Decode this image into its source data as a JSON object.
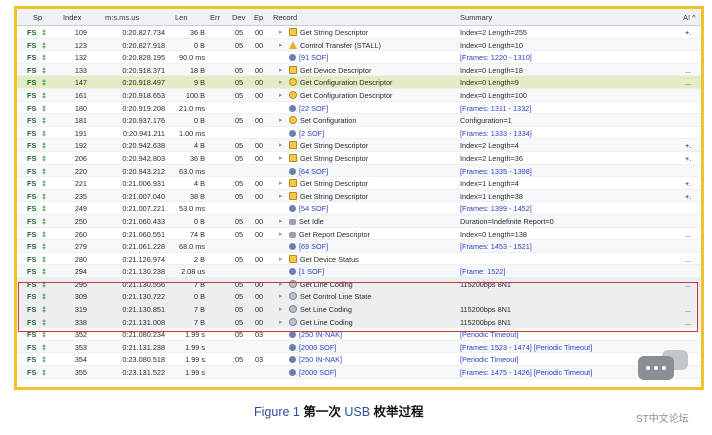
{
  "table": {
    "headers": {
      "sp": "Sp",
      "index": "Index",
      "time": "m:s.ms.us",
      "len": "Len",
      "err": "Err",
      "dev": "Dev",
      "ep": "Ep",
      "record": "Record",
      "summary": "Summary",
      "extra": "A! ^"
    },
    "rows": [
      {
        "sp": "FS",
        "index": "109",
        "time": "0:20.827.734",
        "len": "36 B",
        "dev": "05",
        "ep": "00",
        "icon": "descriptor-icon",
        "record": "Get String Descriptor",
        "summary": "Index=2 Length=255",
        "extra": "+."
      },
      {
        "sp": "FS",
        "index": "123",
        "time": "0:20.827.918",
        "len": "0 B",
        "dev": "05",
        "ep": "00",
        "icon": "warning-icon",
        "record": "Control Transfer (STALL)",
        "summary": "Index=0 Length=10",
        "extra": ""
      },
      {
        "sp": "FS",
        "index": "132",
        "time": "0:20.828.195",
        "len": "90.0 ms",
        "dev": "",
        "ep": "",
        "icon": "sof-icon",
        "record": "[91 SOF]",
        "summary": "[Frames: 1220 - 1310]",
        "extra": ""
      },
      {
        "sp": "FS",
        "index": "133",
        "time": "0:20.918.371",
        "len": "18 B",
        "dev": "05",
        "ep": "00",
        "icon": "descriptor-icon",
        "record": "Get Device Descriptor",
        "summary": "Index=0 Length=18",
        "extra": "..."
      },
      {
        "sp": "FS",
        "index": "147",
        "time": "0:20.918.497",
        "len": "9 B",
        "dev": "05",
        "ep": "00",
        "icon": "config-icon",
        "record": "Get Configuration Descriptor",
        "summary": "Index=0 Length=9",
        "extra": "..."
      },
      {
        "sp": "FS",
        "index": "161",
        "time": "0:20.918.653",
        "len": "100 B",
        "dev": "05",
        "ep": "00",
        "icon": "config-icon",
        "record": "Get Configuration Descriptor",
        "summary": "Index=0 Length=100",
        "extra": ""
      },
      {
        "sp": "FS",
        "index": "180",
        "time": "0:20.919.208",
        "len": "21.0 ms",
        "dev": "",
        "ep": "",
        "icon": "sof-icon",
        "record": "[22 SOF]",
        "summary": "[Frames: 1311 - 1332]",
        "extra": ""
      },
      {
        "sp": "FS",
        "index": "181",
        "time": "0:20.937.176",
        "len": "0 B",
        "dev": "05",
        "ep": "00",
        "icon": "config-icon",
        "record": "Set Configuration",
        "summary": "Configuration=1",
        "extra": ""
      },
      {
        "sp": "FS",
        "index": "191",
        "time": "0:20.941.211",
        "len": "1.00 ms",
        "dev": "",
        "ep": "",
        "icon": "sof-icon",
        "record": "[2 SOF]",
        "summary": "[Frames: 1333 - 1334]",
        "extra": ""
      },
      {
        "sp": "FS",
        "index": "192",
        "time": "0:20.942.638",
        "len": "4 B",
        "dev": "05",
        "ep": "00",
        "icon": "descriptor-icon",
        "record": "Get String Descriptor",
        "summary": "Index=2 Length=4",
        "extra": "+."
      },
      {
        "sp": "FS",
        "index": "206",
        "time": "0:20.942.803",
        "len": "36 B",
        "dev": "05",
        "ep": "00",
        "icon": "descriptor-icon",
        "record": "Get String Descriptor",
        "summary": "Index=2 Length=36",
        "extra": "+."
      },
      {
        "sp": "FS",
        "index": "220",
        "time": "0:20.943.212",
        "len": "63.0 ms",
        "dev": "",
        "ep": "",
        "icon": "sof-icon",
        "record": "[64 SOF]",
        "summary": "[Frames: 1335 - 1398]",
        "extra": ""
      },
      {
        "sp": "FS",
        "index": "221",
        "time": "0:21.006.931",
        "len": "4 B",
        "dev": "05",
        "ep": "00",
        "icon": "descriptor-icon",
        "record": "Get String Descriptor",
        "summary": "Index=1 Length=4",
        "extra": "+."
      },
      {
        "sp": "FS",
        "index": "235",
        "time": "0:21.007.040",
        "len": "38 B",
        "dev": "05",
        "ep": "00",
        "icon": "descriptor-icon",
        "record": "Get String Descriptor",
        "summary": "Index=1 Length=38",
        "extra": "+."
      },
      {
        "sp": "FS",
        "index": "249",
        "time": "0:21.007.221",
        "len": "53.0 ms",
        "dev": "",
        "ep": "",
        "icon": "sof-icon",
        "record": "[54 SOF]",
        "summary": "[Frames: 1399 - 1452]",
        "extra": ""
      },
      {
        "sp": "FS",
        "index": "250",
        "time": "0:21.060.433",
        "len": "0 B",
        "dev": "05",
        "ep": "00",
        "icon": "hid-icon",
        "record": "Set Idle",
        "summary": "Duration=Indefinite Report=0",
        "extra": ""
      },
      {
        "sp": "FS",
        "index": "260",
        "time": "0:21.060.551",
        "len": "74 B",
        "dev": "05",
        "ep": "00",
        "icon": "hid-icon",
        "record": "Get Report Descriptor",
        "summary": "Index=0 Length=138",
        "extra": "..."
      },
      {
        "sp": "FS",
        "index": "279",
        "time": "0:21.061.228",
        "len": "68.0 ms",
        "dev": "",
        "ep": "",
        "icon": "sof-icon",
        "record": "[69 SOF]",
        "summary": "[Frames: 1453 - 1521]",
        "extra": ""
      },
      {
        "sp": "FS",
        "index": "280",
        "time": "0:21.126.974",
        "len": "2 B",
        "dev": "05",
        "ep": "00",
        "icon": "descriptor-icon",
        "record": "Get Device Status",
        "summary": "",
        "extra": "..."
      },
      {
        "sp": "FS",
        "index": "294",
        "time": "0:21.130.238",
        "len": "2.08 us",
        "dev": "",
        "ep": "",
        "icon": "sof-icon",
        "record": "[1 SOF]",
        "summary": "[Frame: 1522]",
        "extra": ""
      },
      {
        "sp": "FS",
        "index": "295",
        "time": "0:21.130.556",
        "len": "7 B",
        "dev": "05",
        "ep": "00",
        "icon": "cdc-icon",
        "record": "Get Line Coding",
        "summary": "115200bps 8N1",
        "extra": "..."
      },
      {
        "sp": "FS",
        "index": "309",
        "time": "0:21.130.722",
        "len": "0 B",
        "dev": "05",
        "ep": "00",
        "icon": "cdc-icon",
        "record": "Set Control Line State",
        "summary": "",
        "extra": ""
      },
      {
        "sp": "FS",
        "index": "319",
        "time": "0:21.130.851",
        "len": "7 B",
        "dev": "05",
        "ep": "00",
        "icon": "cdc-icon",
        "record": "Set Line Coding",
        "summary": "115200bps 8N1",
        "extra": "..."
      },
      {
        "sp": "FS",
        "index": "338",
        "time": "0:21.131.008",
        "len": "7 B",
        "dev": "05",
        "ep": "00",
        "icon": "cdc-icon",
        "record": "Get Line Coding",
        "summary": "115200bps 8N1",
        "extra": "..."
      },
      {
        "sp": "FS",
        "index": "352",
        "time": "0:21.080.234",
        "len": "1.99 s",
        "dev": "05",
        "ep": "03",
        "icon": "sof-icon",
        "record": "[250 IN-NAK]",
        "summary": "[Periodic Timeout]",
        "extra": ""
      },
      {
        "sp": "FS",
        "index": "353",
        "time": "0:21.131.238",
        "len": "1.99 s",
        "dev": "",
        "ep": "",
        "icon": "sof-icon",
        "record": "[2000 SOF]",
        "summary": "[Frames: 1523 - 1474] [Periodic Timeout]",
        "extra": ""
      },
      {
        "sp": "FS",
        "index": "354",
        "time": "0:23.080.518",
        "len": "1.99 s",
        "dev": "05",
        "ep": "03",
        "icon": "sof-icon",
        "record": "[250 IN-NAK]",
        "summary": "[Periodic Timeout]",
        "extra": ""
      },
      {
        "sp": "FS",
        "index": "355",
        "time": "0:23.131.522",
        "len": "1.99 s",
        "dev": "",
        "ep": "",
        "icon": "sof-icon",
        "record": "[2000 SOF]",
        "summary": "[Frames: 1475 - 1426] [Periodic Timeout]",
        "extra": ""
      }
    ]
  },
  "caption": {
    "prefix": "Figure 1",
    "title": "第一次",
    "usb": "USB",
    "rest": "枚举过程"
  },
  "watermark": {
    "text": "ST中文论坛"
  },
  "colors": {
    "frame_border": "#f2c12e",
    "highlight_box": "#d0353a",
    "selected_row": "#e2edc4",
    "sof_text": "#2a42c4",
    "caption_text": "#2f4f9a"
  }
}
